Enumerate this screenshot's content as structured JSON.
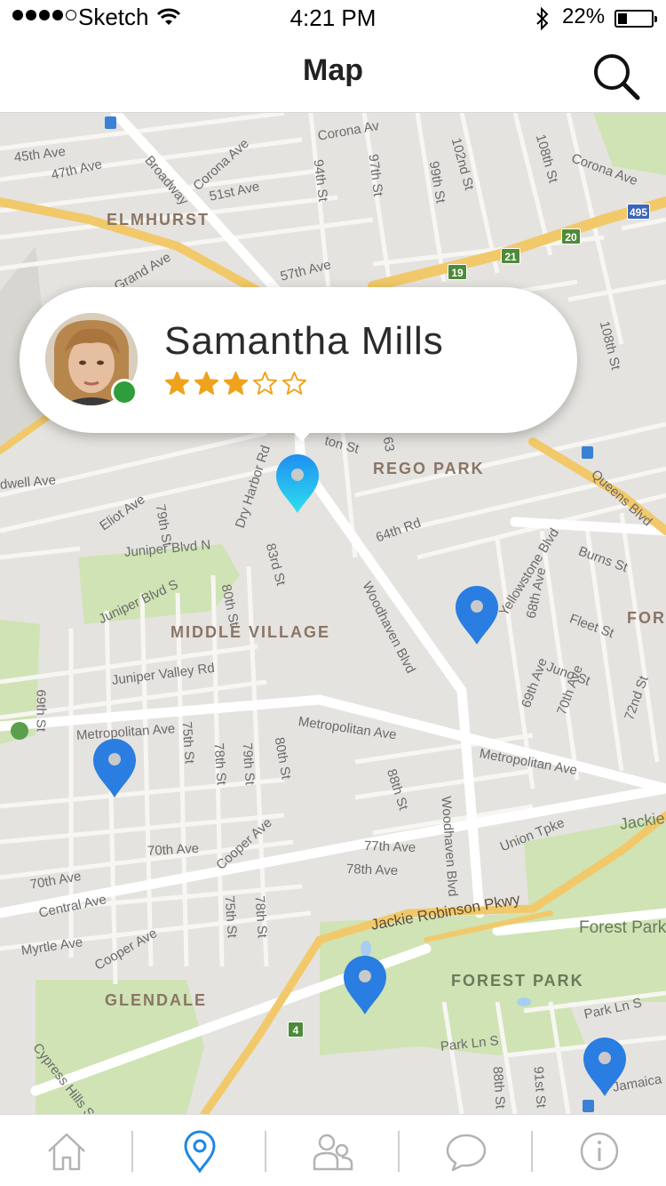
{
  "status_bar": {
    "carrier": "Sketch",
    "time": "4:21 PM",
    "battery": "22%"
  },
  "nav": {
    "title": "Map",
    "search_icon": "search-icon"
  },
  "map": {
    "area_labels": [
      "ELMHURST",
      "REGO PARK",
      "MIDDLE VILLAGE",
      "GLENDALE",
      "FOREST PARK",
      "FORE"
    ],
    "street_labels": [
      "45th Ave",
      "47th Ave",
      "Broadway",
      "Corona Ave",
      "51st Ave",
      "Corona Av",
      "94th St",
      "97th St",
      "99th St",
      "102nd St",
      "108th St",
      "Corona Ave",
      "Grand Ave",
      "57th Ave",
      "108th St",
      "dwell Ave",
      "Eliot Ave",
      "79th St",
      "Dry Harbor Rd",
      "ton St",
      "63",
      "Juniper Blvd N",
      "83rd St",
      "64th Rd",
      "Yellowstone Blvd",
      "Burns St",
      "Queens Blvd",
      "Juniper Blvd S",
      "80th St",
      "Woodhaven Blvd",
      "68th Ave",
      "Fleet St",
      "Juno St",
      "Juniper Valley Rd",
      "69th St",
      "Metropolitan Ave",
      "Metropolitan Ave",
      "Metropolitan Ave",
      "75th St",
      "78th St",
      "79th St",
      "80th St",
      "69th Ave",
      "70th Ave",
      "72nd St",
      "88th St",
      "Woodhaven Blvd",
      "Union Tpke",
      "Jackie",
      "70th Ave",
      "Cooper Ave",
      "77th Ave",
      "78th Ave",
      "70th Ave",
      "Central Ave",
      "75th St",
      "78th St",
      "Myrtle Ave",
      "Cooper Ave",
      "Jackie Robinson Pkwy",
      "Forest Park",
      "Cypress Hills St",
      "Park Ln S",
      "Park Ln S",
      "88th St",
      "91st St",
      "Jamaica"
    ],
    "shields": [
      "495",
      "20",
      "21",
      "19",
      "4"
    ],
    "pins": 5
  },
  "callout": {
    "name": "Samantha Mills",
    "rating": 3,
    "max_rating": 5,
    "status": "online",
    "status_color": "#2e9e3c"
  },
  "tabs": [
    {
      "id": "home",
      "icon": "home-icon",
      "active": false
    },
    {
      "id": "map",
      "icon": "map-pin-icon",
      "active": true
    },
    {
      "id": "people",
      "icon": "people-icon",
      "active": false
    },
    {
      "id": "chat",
      "icon": "chat-bubble-icon",
      "active": false
    },
    {
      "id": "info",
      "icon": "info-icon",
      "active": false
    }
  ],
  "colors": {
    "accent": "#1e88e5",
    "pin": "#2a7de1",
    "pin_active_top": "#1e8ff0",
    "pin_active_bottom": "#2ee0f0",
    "star": "#f0a21c",
    "map_bg": "#e5e3df",
    "park": "#cfe3b4",
    "highway": "#f2c96a"
  }
}
